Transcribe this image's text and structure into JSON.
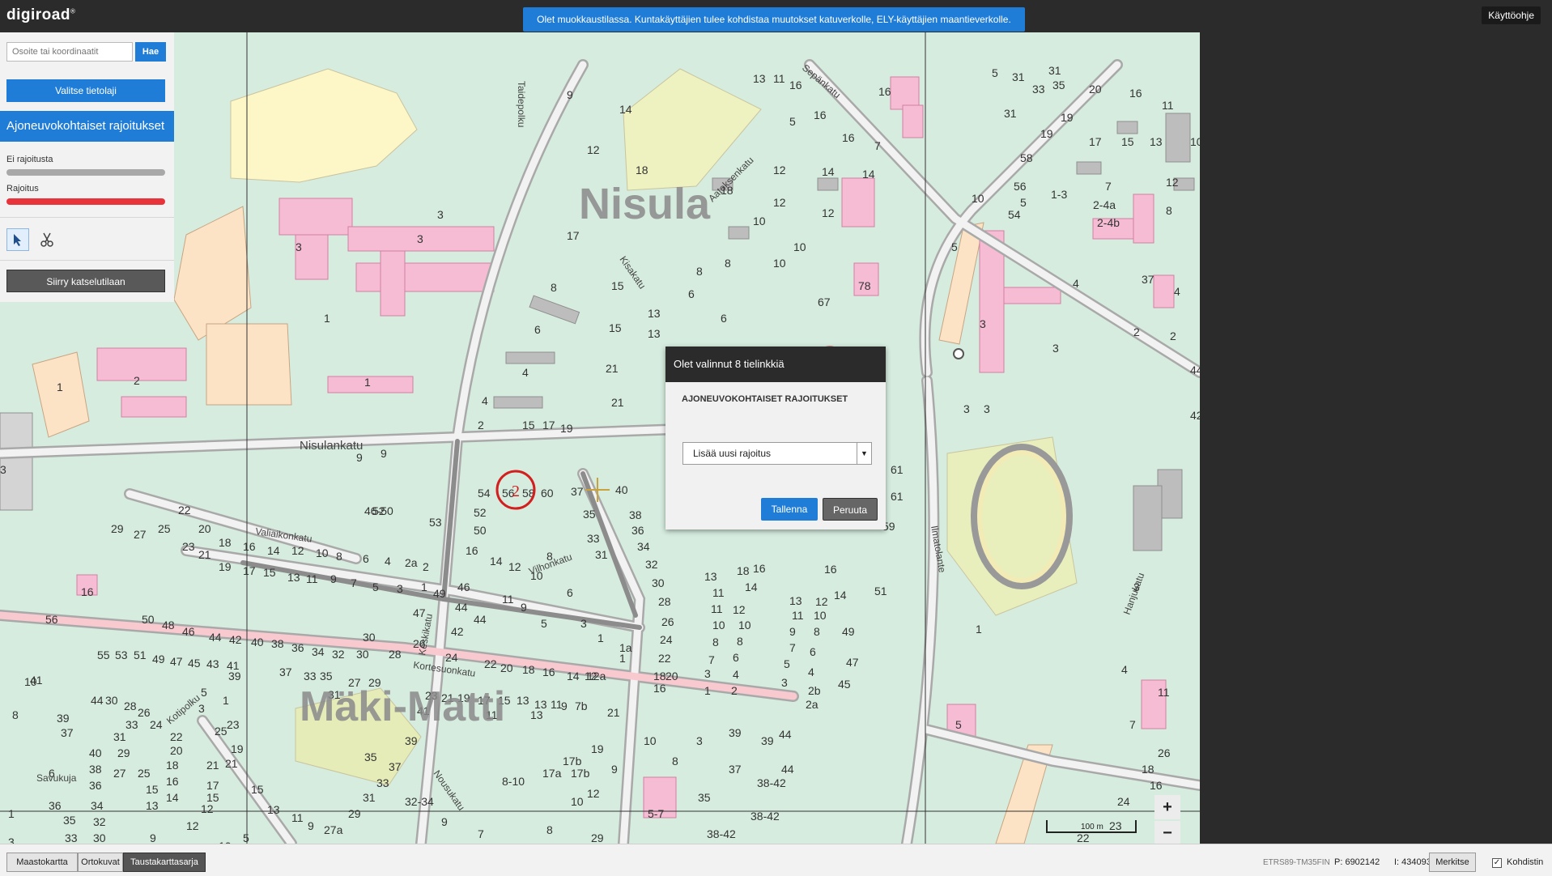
{
  "app": {
    "logo": "digiroad",
    "logo_mark": "®"
  },
  "topbar": {
    "notice": "Olet muokkaustilassa. Kuntakäyttäjien tulee kohdistaa muutokset katuverkolle, ELY-käyttäjien maantieverkolle.",
    "help_label": "Käyttöohje"
  },
  "sidebar": {
    "search_placeholder": "Osoite tai koordinaatit",
    "search_button": "Hae",
    "select_layer_button": "Valitse tietolaji",
    "layer_title": "Ajoneuvokohtaiset rajoitukset",
    "legend": [
      {
        "label": "Ei rajoitusta",
        "color": "#a8a8a8"
      },
      {
        "label": "Rajoitus",
        "color": "#e8333a"
      }
    ],
    "tools": [
      "select-icon",
      "cut-icon"
    ],
    "view_mode_button": "Siirry katselutilaan"
  },
  "map": {
    "place_names": [
      "Nisula",
      "Mäki-Matti"
    ],
    "streets": [
      "Nisulankatu",
      "Kortesuonkatu",
      "Valiaikonkatu",
      "Keskikatu",
      "Kisakatu",
      "Aatoksenkatu",
      "Sepänkatu",
      "Taidepolku",
      "Vilhonkatu",
      "Ilmatolante",
      "Kotipolku",
      "Savukuja",
      "Nousukatu",
      "Hanjukatu"
    ],
    "annotations": [
      "1",
      "2"
    ],
    "scale_label": "100 m",
    "zoom_in": "+",
    "zoom_out": "−"
  },
  "popup": {
    "title": "Olet valinnut 8 tielinkkiä",
    "section": "AJONEUVOKOHTAISET RAJOITUKSET",
    "select_value": "Lisää uusi rajoitus",
    "save_button": "Tallenna",
    "cancel_button": "Peruuta"
  },
  "bottombar": {
    "background_tabs": [
      {
        "label": "Maastokartta",
        "active": false
      },
      {
        "label": "Ortokuvat",
        "active": false
      },
      {
        "label": "Taustakarttasarja",
        "active": true
      }
    ],
    "projection": "ETRS89-TM35FIN",
    "coord_p": "P: 6902142",
    "coord_i": "I: 434093",
    "mark_button": "Merkitse",
    "target_label": "Kohdistin",
    "target_checked": true
  }
}
